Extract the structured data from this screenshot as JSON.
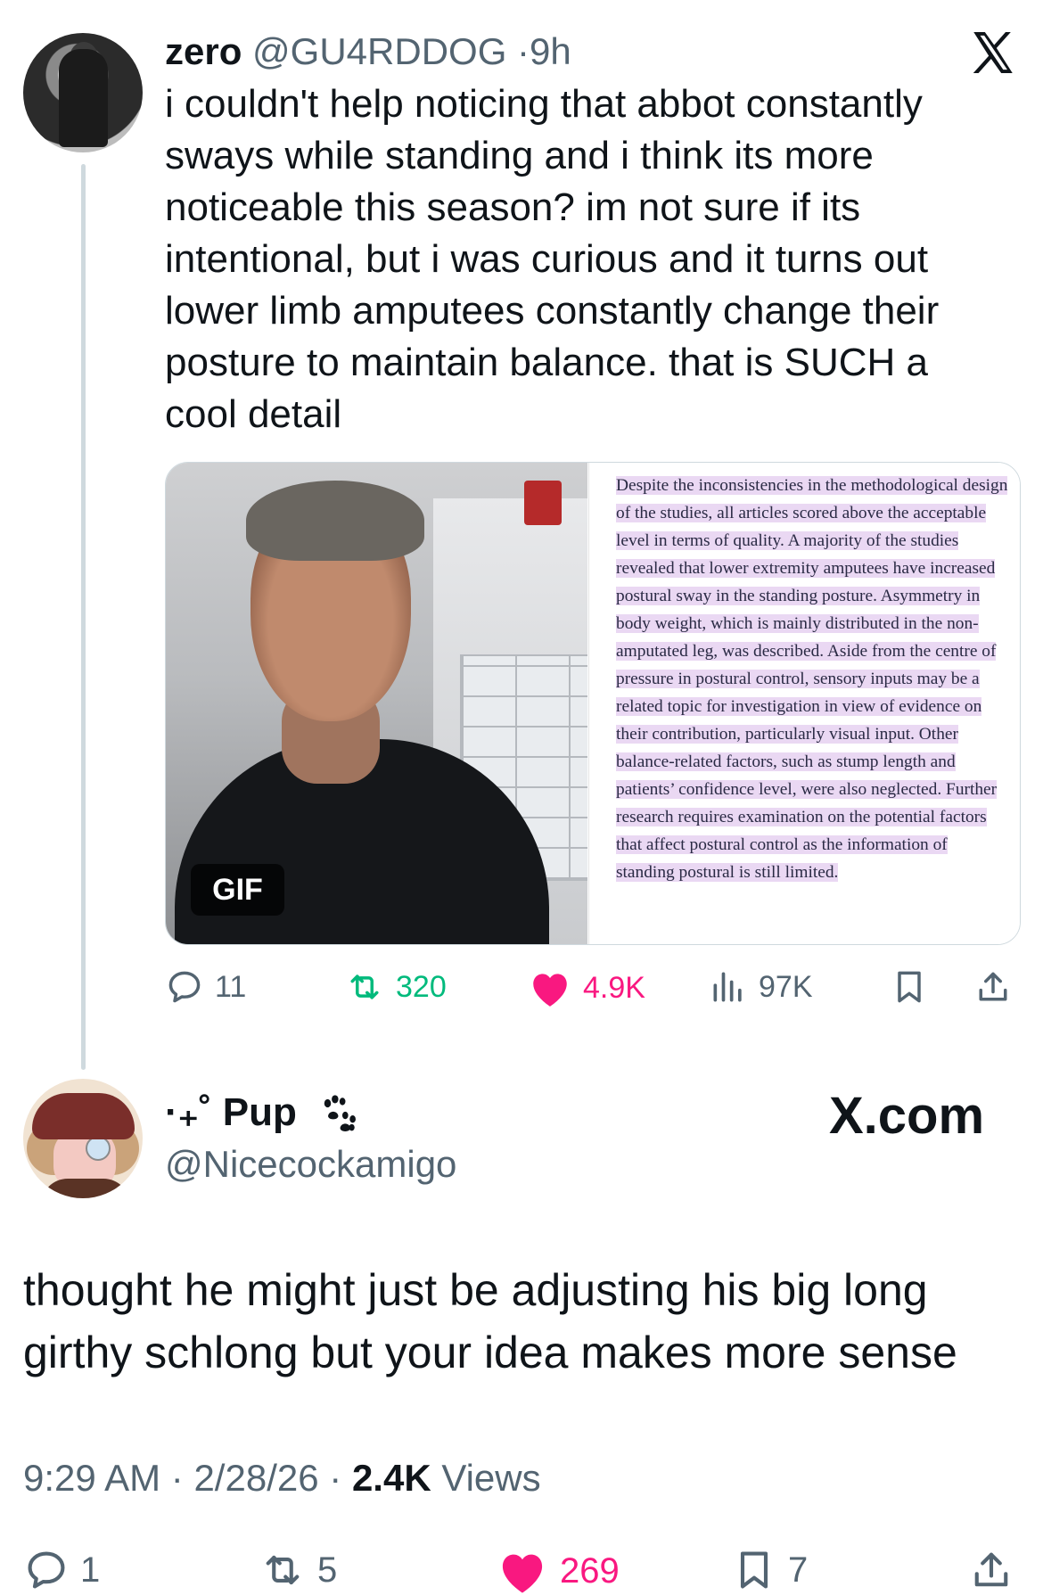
{
  "tweet": {
    "author_name": "zero",
    "author_handle": "@GU4RDDOG",
    "separator": "·",
    "time_ago": "9h",
    "text": "i couldn't help noticing that abbot constantly sways while standing and i think its more noticeable this season? im not sure if its intentional, but i was curious and it turns out lower limb amputees constantly change their posture to maintain balance. that is SUCH a cool detail",
    "media": {
      "gif_badge": "GIF",
      "excerpt": "Despite the inconsistencies in the methodological design of the studies, all articles scored above the acceptable level in terms of quality. A majority of the studies revealed that lower extremity amputees have increased postural sway in the standing posture. Asymmetry in body weight, which is mainly distributed in the non-amputated leg, was described. Aside from the centre of pressure in postural control, sensory inputs may be a related topic for investigation in view of evidence on their contribution, particularly visual input. Other balance-related factors, such as stump length and patients’ confidence level, were also neglected. Further research requires examination on the potential factors that affect postural control as the information of standing postural is still limited.",
      "highlight_color": "#ead8f3"
    },
    "actions": {
      "replies": "11",
      "reposts": "320",
      "likes": "4.9K",
      "views": "97K"
    }
  },
  "reply": {
    "name_prefix": "·₊˚",
    "author_name": "Pup",
    "author_handle": "@Nicecockamigo",
    "watermark": "X.com",
    "text": "thought he might just be adjusting his big long girthy schlong but your idea makes more sense",
    "meta": {
      "time": "9:29 AM",
      "separator": "·",
      "date": "2/28/26",
      "views_count": "2.4K",
      "views_label": "Views"
    },
    "actions": {
      "replies": "1",
      "reposts": "5",
      "likes": "269",
      "bookmarks": "7"
    }
  },
  "colors": {
    "text": "#0f1419",
    "secondary": "#536471",
    "repost": "#00ba7c",
    "like": "#f91880"
  },
  "icons": [
    "x-logo-icon",
    "reply-icon",
    "repost-icon",
    "like-icon",
    "views-icon",
    "bookmark-icon",
    "share-icon",
    "paw-icon"
  ]
}
